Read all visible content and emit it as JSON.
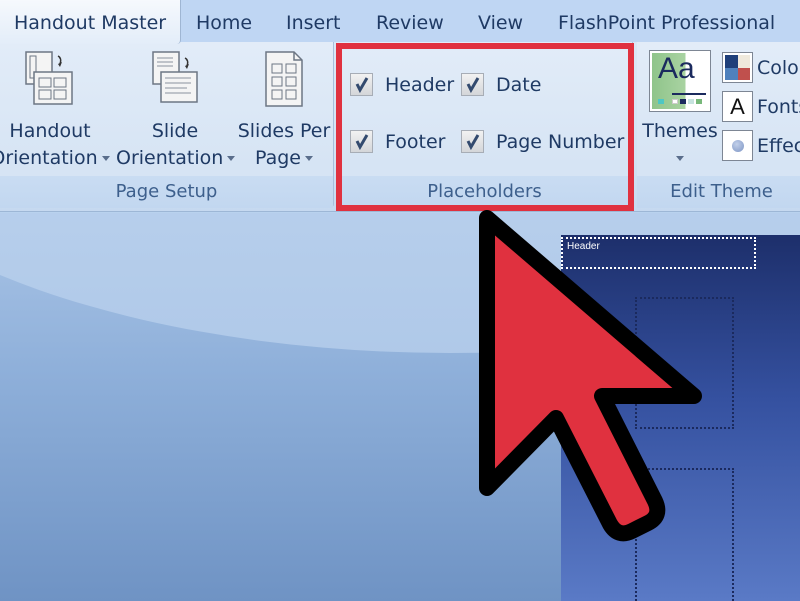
{
  "tabs": [
    {
      "label": "Handout Master",
      "active": true
    },
    {
      "label": "Home",
      "active": false
    },
    {
      "label": "Insert",
      "active": false
    },
    {
      "label": "Review",
      "active": false
    },
    {
      "label": "View",
      "active": false
    },
    {
      "label": "FlashPoint Professional",
      "active": false
    }
  ],
  "ribbon": {
    "page_setup": {
      "label": "Page Setup",
      "buttons": [
        {
          "line1": "Handout",
          "line2": "Orientation",
          "icon": "handout-orientation-icon"
        },
        {
          "line1": "Slide",
          "line2": "Orientation",
          "icon": "slide-orientation-icon"
        },
        {
          "line1": "Slides Per",
          "line2": "Page",
          "icon": "slides-per-page-icon"
        }
      ]
    },
    "placeholders": {
      "label": "Placeholders",
      "checkboxes": [
        {
          "label": "Header",
          "checked": true
        },
        {
          "label": "Date",
          "checked": true
        },
        {
          "label": "Footer",
          "checked": true
        },
        {
          "label": "Page Number",
          "checked": true
        }
      ]
    },
    "edit_theme": {
      "label": "Edit Theme",
      "themes_label": "Themes",
      "themes_icon_text": "Aa",
      "small_buttons": [
        {
          "label": "Colors",
          "icon": "colors-icon"
        },
        {
          "label": "Fonts",
          "icon": "fonts-icon",
          "glyph": "A"
        },
        {
          "label": "Effects",
          "icon": "effects-icon"
        }
      ]
    }
  },
  "slide": {
    "header_placeholder": "Header"
  },
  "annotation": {
    "highlight_color": "#e0313f",
    "arrow_color": "#e0313f"
  }
}
